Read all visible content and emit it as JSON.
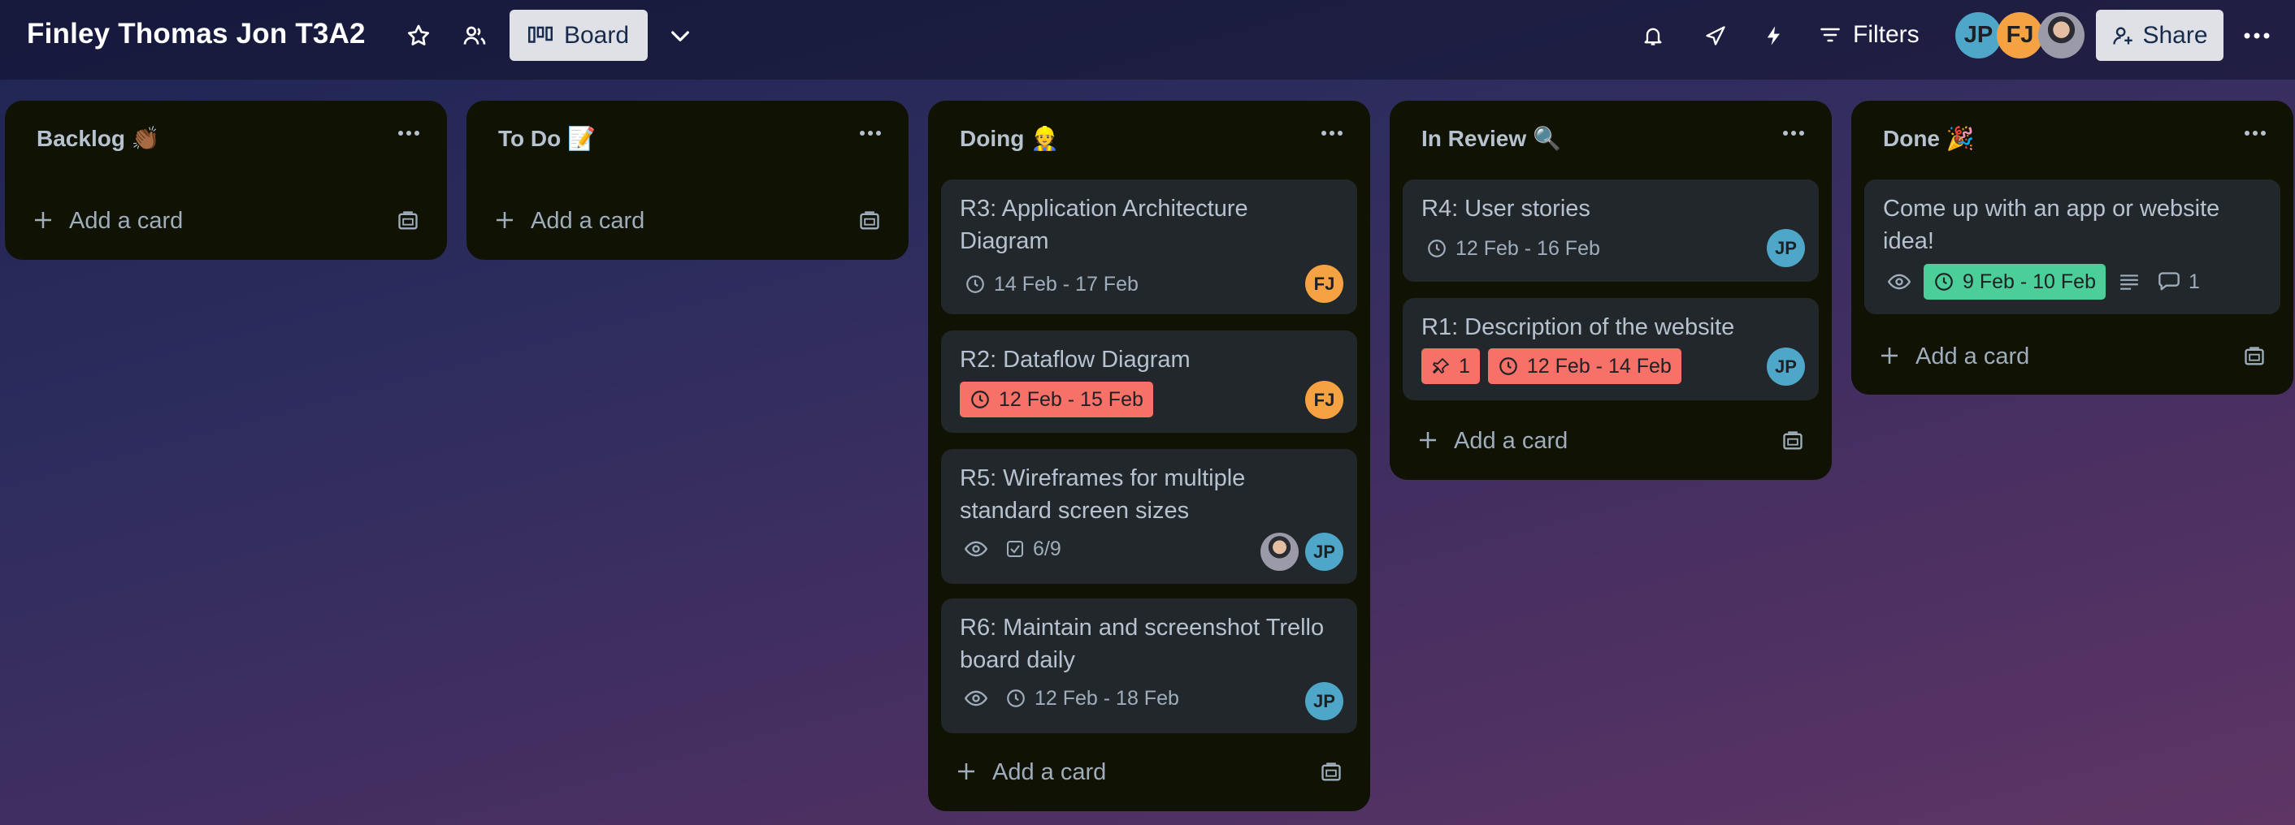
{
  "header": {
    "board_title": "Finley Thomas Jon T3A2",
    "view_label": "Board",
    "filters_label": "Filters",
    "share_label": "Share",
    "members": [
      {
        "initials": "JP",
        "color": "#4ea6c9"
      },
      {
        "initials": "FJ",
        "color": "#f5a243"
      },
      {
        "initials": "",
        "photo": true
      }
    ],
    "icons": [
      "star-icon",
      "workspace-visibility-icon",
      "board-icon",
      "chevron-down-icon",
      "bell-icon",
      "rocket-icon",
      "lightning-icon",
      "filter-icon",
      "add-member-icon",
      "more-icon"
    ]
  },
  "common": {
    "add_card_label": "Add a card"
  },
  "lists": [
    {
      "title": "Backlog 👏🏾",
      "cards": []
    },
    {
      "title": "To Do 📝",
      "cards": []
    },
    {
      "title": "Doing 👷",
      "cards": [
        {
          "title": "R3: Application Architecture Diagram",
          "date": "14 Feb - 17 Feb",
          "date_status": "normal",
          "members": [
            "FJ"
          ]
        },
        {
          "title": "R2: Dataflow Diagram",
          "date": "12 Feb - 15 Feb",
          "date_status": "overdue",
          "members": [
            "FJ"
          ]
        },
        {
          "title": "R5: Wireframes for multiple standard screen sizes",
          "watching": true,
          "checklist": "6/9",
          "members": [
            "photo",
            "JP"
          ]
        },
        {
          "title": "R6: Maintain and screenshot Trello board daily",
          "watching": true,
          "date": "12 Feb - 18 Feb",
          "date_status": "normal",
          "members": [
            "JP"
          ]
        }
      ]
    },
    {
      "title": "In Review 🔍",
      "cards": [
        {
          "title": "R4: User stories",
          "date": "12 Feb - 16 Feb",
          "date_status": "normal",
          "members": [
            "JP"
          ]
        },
        {
          "title": "R1: Description of the website",
          "votes": "1",
          "date": "12 Feb - 14 Feb",
          "date_status": "overdue",
          "members": [
            "JP"
          ]
        }
      ]
    },
    {
      "title": "Done 🎉",
      "cards": [
        {
          "title": "Come up with an app or website idea!",
          "watching": true,
          "date": "9 Feb - 10 Feb",
          "date_status": "complete",
          "has_description": true,
          "comments": "1",
          "members": []
        }
      ]
    }
  ],
  "colors": {
    "overdue": "#f87168",
    "complete": "#4bce97",
    "list_bg": "#101204",
    "card_bg": "#22272b"
  }
}
